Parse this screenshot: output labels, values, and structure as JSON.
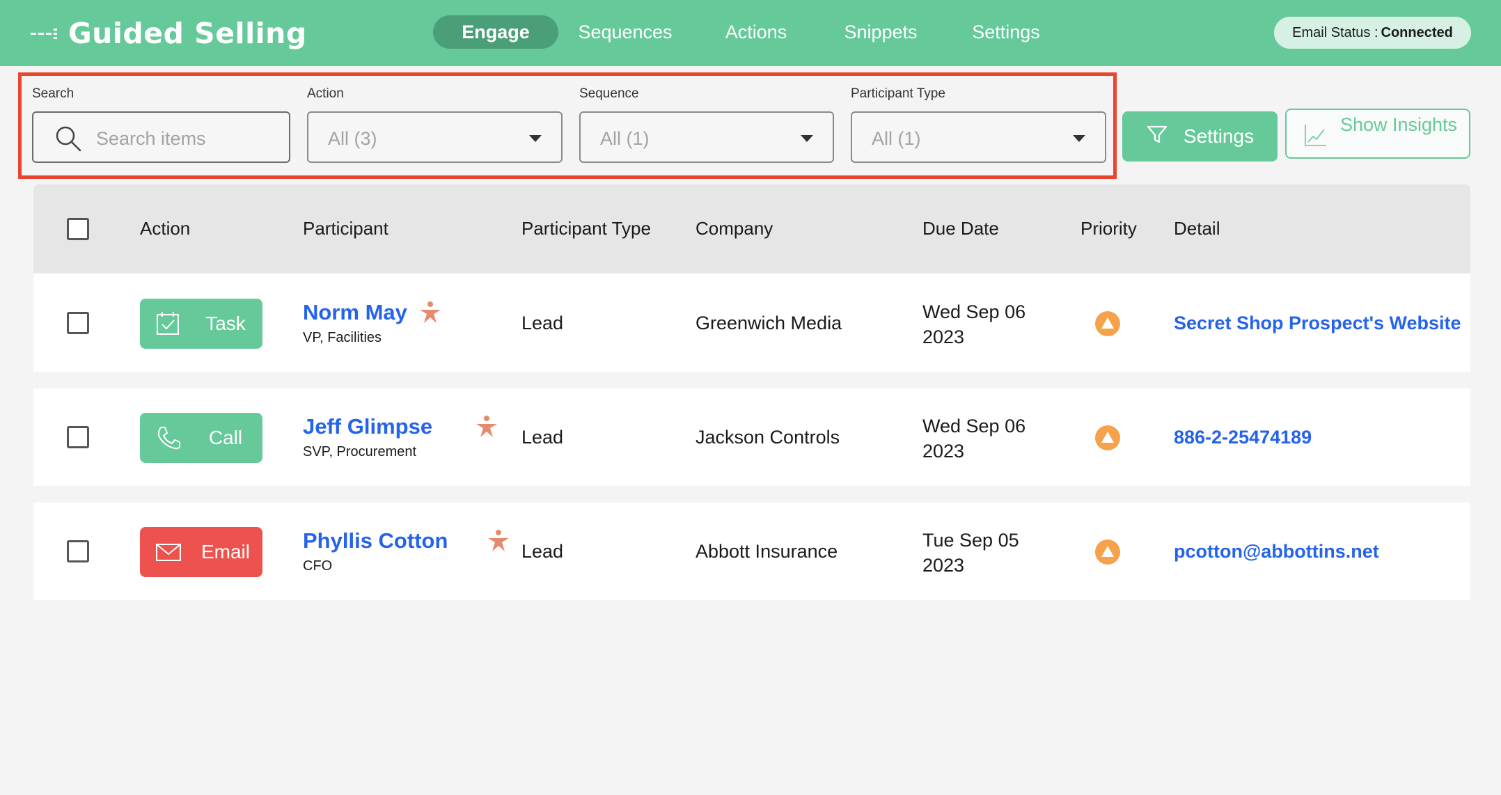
{
  "header": {
    "app_title": "Guided Selling",
    "tabs": [
      {
        "label": "Engage",
        "active": true
      },
      {
        "label": "Sequences",
        "active": false
      },
      {
        "label": "Actions",
        "active": false
      },
      {
        "label": "Snippets",
        "active": false
      },
      {
        "label": "Settings",
        "active": false
      }
    ],
    "email_status_label": "Email Status :",
    "email_status_value": "Connected"
  },
  "filters": {
    "search_label": "Search",
    "search_placeholder": "Search items",
    "action_label": "Action",
    "action_value": "All (3)",
    "sequence_label": "Sequence",
    "sequence_value": "All (1)",
    "participant_type_label": "Participant Type",
    "participant_type_value": "All (1)",
    "settings_button": "Settings",
    "insights_button": "Show Insights"
  },
  "table": {
    "columns": [
      "Action",
      "Participant",
      "Participant Type",
      "Company",
      "Due Date",
      "Priority",
      "Detail"
    ],
    "rows": [
      {
        "action": "Task",
        "action_icon": "task-check-icon",
        "action_color": "#66c99a",
        "name": "Norm May",
        "title": "VP, Facilities",
        "type": "Lead",
        "company": "Greenwich Media",
        "due_line1": "Wed Sep 06",
        "due_line2": "2023",
        "priority_icon": "priority-up-icon",
        "detail": "Secret Shop Prospect's Website"
      },
      {
        "action": "Call",
        "action_icon": "phone-icon",
        "action_color": "#66c99a",
        "name": "Jeff Glimpse",
        "title": "SVP, Procurement",
        "type": "Lead",
        "company": "Jackson Controls",
        "due_line1": "Wed Sep 06",
        "due_line2": "2023",
        "priority_icon": "priority-up-icon",
        "detail": "886-2-25474189"
      },
      {
        "action": "Email",
        "action_icon": "envelope-icon",
        "action_color": "#ee524f",
        "name": "Phyllis Cotton",
        "title": "CFO",
        "type": "Lead",
        "company": "Abbott Insurance",
        "due_line1": "Tue Sep 05",
        "due_line2": "2023",
        "priority_icon": "priority-up-icon",
        "detail": "pcotton@abbottins.net"
      }
    ]
  },
  "colors": {
    "brand_green": "#66c99a",
    "active_tab": "#4a9f78",
    "link_blue": "#2563eb",
    "email_red": "#ee524f",
    "priority_orange": "#f5a24a",
    "highlight_red": "#e8462e"
  }
}
